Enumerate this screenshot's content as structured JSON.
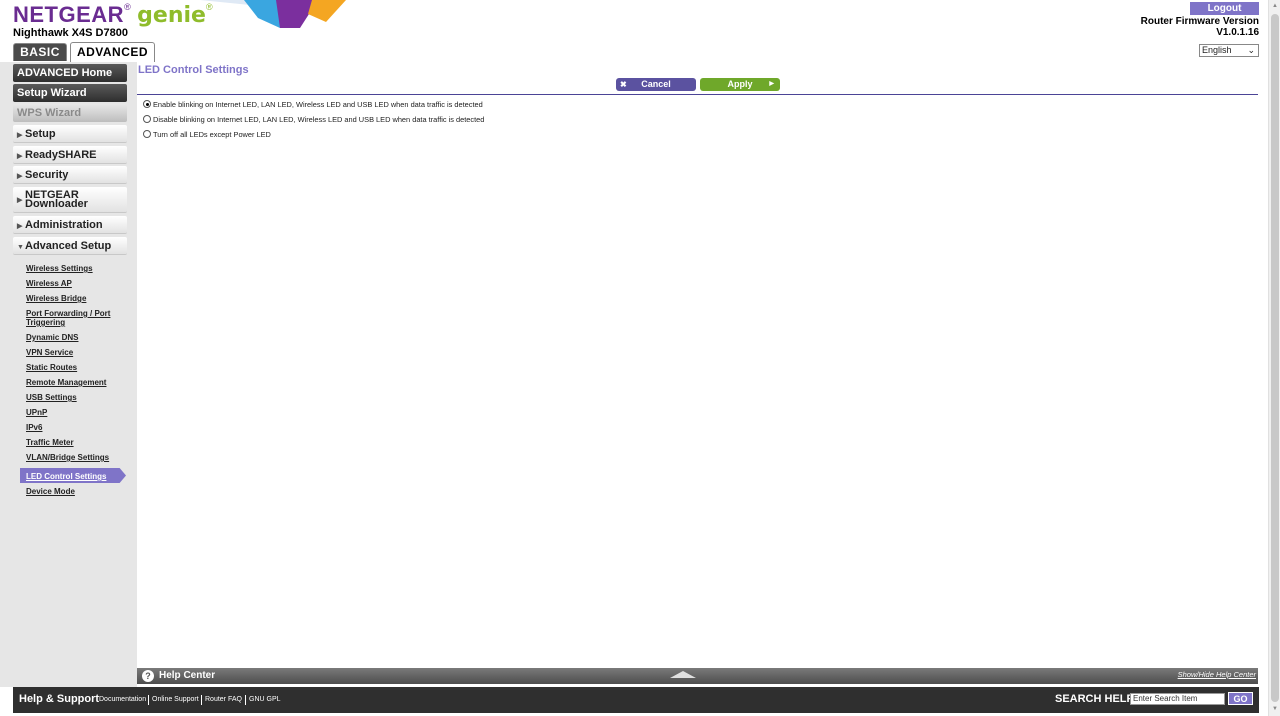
{
  "header": {
    "brand": "NETGEAR",
    "brand_mark": "®",
    "product": "genie",
    "product_mark": "®",
    "model": "Nighthawk X4S D7800",
    "tabs": {
      "basic": "BASIC",
      "advanced": "ADVANCED"
    },
    "logout": "Logout",
    "firmware_label": "Router Firmware Version",
    "firmware_version": "V1.0.1.16",
    "language": "English",
    "colors": {
      "accent": "#7f74c8",
      "brand": "#6a2c91",
      "genie": "#8fbc2b"
    }
  },
  "sidebar": {
    "top_buttons": [
      "ADVANCED Home",
      "Setup Wizard",
      "WPS Wizard"
    ],
    "sections": [
      "Setup",
      "ReadySHARE",
      "Security",
      "NETGEAR Downloader",
      "Administration",
      "Advanced Setup"
    ],
    "downloader_line1": "NETGEAR",
    "downloader_line2": "Downloader",
    "sublinks": [
      "Wireless Settings",
      "Wireless AP",
      "Wireless Bridge",
      "Port Forwarding / Port",
      "Triggering",
      "Dynamic DNS",
      "VPN Service",
      "Static Routes",
      "Remote Management",
      "USB Settings",
      "UPnP",
      "IPv6",
      "Traffic Meter",
      "VLAN/Bridge Settings",
      "LED Control Settings",
      "Device Mode"
    ],
    "active_sublink": "LED Control Settings"
  },
  "main": {
    "title": "LED Control Settings",
    "cancel_label": "Cancel",
    "apply_label": "Apply",
    "options": [
      {
        "label": "Enable blinking on Internet LED, LAN LED, Wireless LED and USB LED when data traffic is detected",
        "checked": true
      },
      {
        "label": "Disable blinking on Internet LED, LAN LED, Wireless LED and USB LED when data traffic is detected",
        "checked": false
      },
      {
        "label": "Turn off all LEDs except Power LED",
        "checked": false
      }
    ]
  },
  "help": {
    "title": "Help Center",
    "toggle": "Show/Hide Help Center"
  },
  "footer": {
    "title": "Help & Support",
    "links": [
      "Documentation",
      "Online Support",
      "Router FAQ",
      "GNU GPL"
    ],
    "search_label": "SEARCH HELP",
    "search_value": "Enter Search Item",
    "go": "GO"
  }
}
